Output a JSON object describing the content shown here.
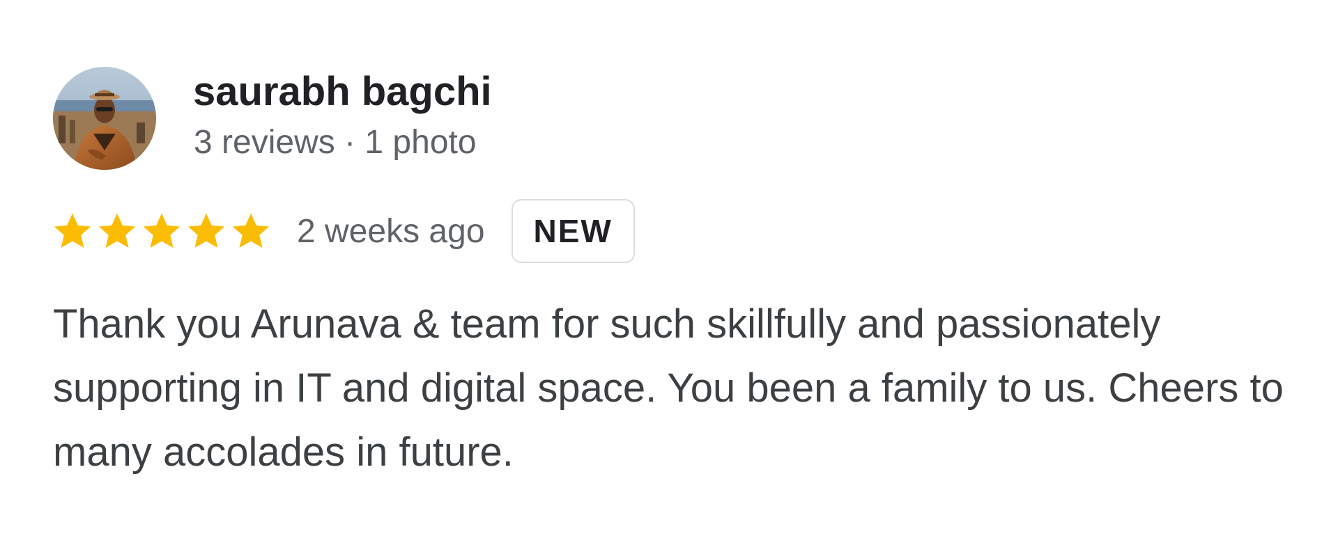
{
  "review": {
    "reviewer": {
      "name": "saurabh bagchi",
      "meta": "3 reviews · 1 photo",
      "avatar_icon": "reviewer-avatar-photo"
    },
    "rating": {
      "stars": 5,
      "max_stars": 5,
      "star_color": "#fbbc04"
    },
    "date": "2 weeks ago",
    "badge": "NEW",
    "text": "Thank you Arunava & team for such skillfully and passionately supporting in IT and digital space. You been a family to us. Cheers to many accolades in future."
  }
}
